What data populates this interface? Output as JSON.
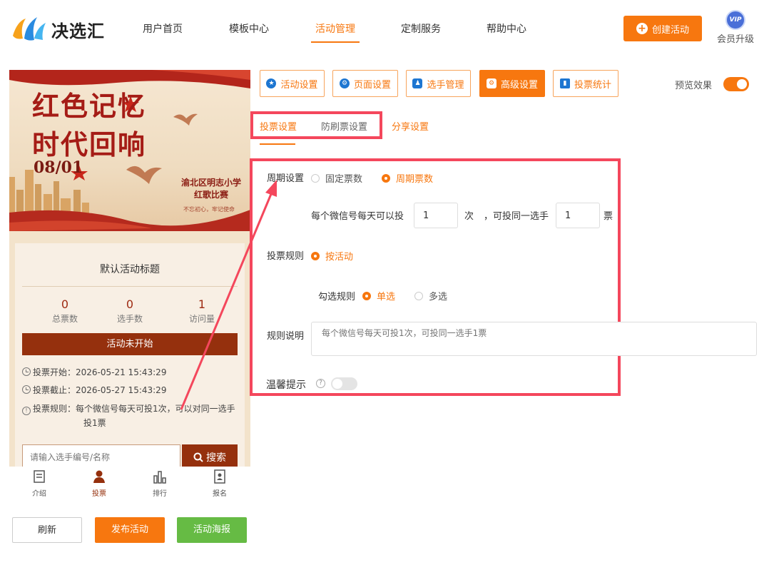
{
  "header": {
    "brand": "决选汇",
    "nav": [
      "用户首页",
      "模板中心",
      "活动管理",
      "定制服务",
      "帮助中心"
    ],
    "create_button": "创建活动",
    "vip_badge": "VIP",
    "vip_label": "会员升级"
  },
  "preview": {
    "banner": {
      "title_line1": "红色记忆",
      "title_line2": "时代回响",
      "date": "08/01",
      "school_line1": "渝北区明志小学",
      "school_line2": "红歌比赛",
      "slogan": "不忘初心，牢记使命"
    },
    "activity_title": "默认活动标题",
    "stats": [
      {
        "value": "0",
        "label": "总票数"
      },
      {
        "value": "0",
        "label": "选手数"
      },
      {
        "value": "1",
        "label": "访问量"
      }
    ],
    "status": "活动未开始",
    "vote_start": "投票开始：2026-05-21 15:43:29",
    "vote_end": "投票截止：2026-05-27 15:43:29",
    "vote_rule_line1": "投票规则：每个微信号每天可投1次，可以对同一选手",
    "vote_rule_line2": "投1票",
    "search_placeholder": "请输入选手编号/名称",
    "search_button": "搜索",
    "tabs": [
      "介绍",
      "投票",
      "排行",
      "报名"
    ]
  },
  "bottom_buttons": {
    "refresh": "刷新",
    "publish": "发布活动",
    "poster": "活动海报"
  },
  "toolbar": [
    "活动设置",
    "页面设置",
    "选手管理",
    "高级设置",
    "投票统计"
  ],
  "preview_effect_label": "预览效果",
  "subtabs": [
    "投票设置",
    "防刷票设置",
    "分享设置"
  ],
  "settings": {
    "period_label": "周期设置",
    "period_options": [
      "固定票数",
      "周期票数"
    ],
    "per_day_text": "每个微信号每天可以投",
    "per_day_value": "1",
    "times_unit": "次",
    "same_player_text": "，可投同一选手",
    "same_player_value": "1",
    "votes_unit": "票",
    "rule_label": "投票规则",
    "rule_option": "按活动",
    "check_rule_label": "勾选规则",
    "check_options": [
      "单选",
      "多选"
    ],
    "description_label": "规则说明",
    "description_placeholder": "每个微信号每天可投1次，可投同一选手1票",
    "tip_label": "温馨提示",
    "help_icon": "?"
  },
  "colors": {
    "accent": "#f7770f",
    "highlight_frame": "#f4475c",
    "preview_dark_red": "#95300d",
    "poster_green": "#66bb44"
  }
}
